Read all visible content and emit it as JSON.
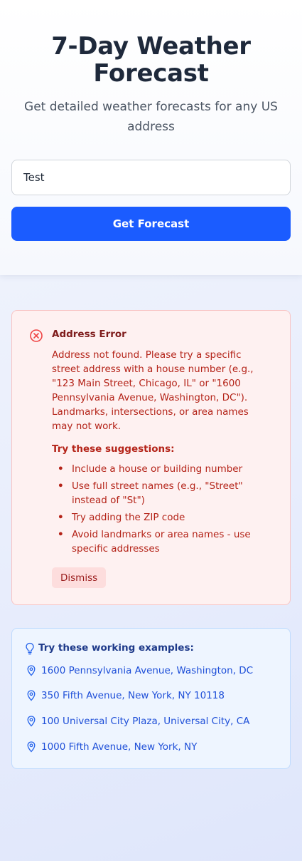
{
  "header": {
    "title_line1": "7-Day Weather",
    "title_line2": "Forecast",
    "subtitle": "Get detailed weather forecasts for any US address"
  },
  "search": {
    "value": "Test",
    "button_label": "Get Forecast"
  },
  "error": {
    "title": "Address Error",
    "message": "Address not found. Please try a specific street address with a house number (e.g., \"123 Main Street, Chicago, IL\" or \"1600 Pennsylvania Avenue, Washington, DC\"). Landmarks, intersections, or area names may not work.",
    "suggestions_heading": "Try these suggestions:",
    "suggestions": [
      "Include a house or building number",
      "Use full street names (e.g., \"Street\" instead of \"St\")",
      "Try adding the ZIP code",
      "Avoid landmarks or area names - use specific addresses"
    ],
    "dismiss_label": "Dismiss"
  },
  "examples": {
    "title": "Try these working examples:",
    "items": [
      "1600 Pennsylvania Avenue, Washington, DC",
      "350 Fifth Avenue, New York, NY 10118",
      "100 Universal City Plaza, Universal City, CA",
      "1000 Fifth Avenue, New York, NY"
    ]
  },
  "icons": {
    "error": "x-circle-icon",
    "bulb": "lightbulb-icon",
    "pin": "map-pin-icon"
  },
  "colors": {
    "primary": "#1b5cff",
    "error_text": "#b42318",
    "error_bg": "#fef1f1",
    "example_link": "#1e4fd8"
  }
}
